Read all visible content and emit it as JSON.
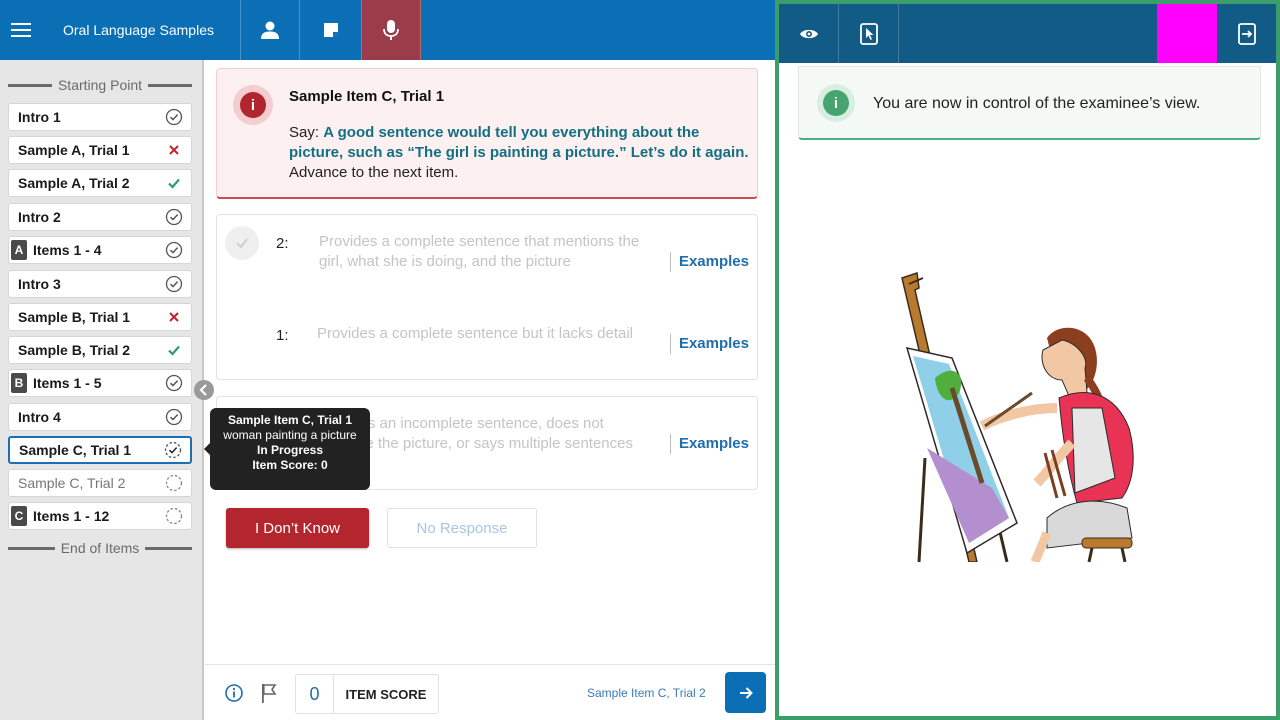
{
  "app": {
    "title": "Oral Language Samples"
  },
  "sidebar": {
    "start_label": "Starting Point",
    "end_label": "End of Items",
    "items": [
      {
        "label": "Intro 1",
        "status": "done"
      },
      {
        "label": "Sample A, Trial 1",
        "status": "incorrect"
      },
      {
        "label": "Sample A, Trial 2",
        "status": "correct"
      },
      {
        "label": "Intro 2",
        "status": "done"
      },
      {
        "badge": "A",
        "label": "Items 1 - 4",
        "status": "done"
      },
      {
        "label": "Intro 3",
        "status": "done"
      },
      {
        "label": "Sample B, Trial 1",
        "status": "incorrect"
      },
      {
        "label": "Sample B, Trial 2",
        "status": "correct"
      },
      {
        "badge": "B",
        "label": "Items 1 - 5",
        "status": "done"
      },
      {
        "label": "Intro 4",
        "status": "done"
      },
      {
        "label": "Sample C, Trial 1",
        "status": "in-progress"
      },
      {
        "label": "Sample C, Trial 2",
        "status": "not-started"
      },
      {
        "badge": "C",
        "label": "Items 1 - 12",
        "status": "not-started"
      }
    ]
  },
  "alert": {
    "title": "Sample Item C, Trial 1",
    "say_prefix": "Say: ",
    "say_highlight": "A good sentence would tell you everything about the picture, such as “The girl is painting a picture.” Let’s do it again.",
    "say_suffix": " Advance to the next item."
  },
  "scoring": [
    {
      "score": "2:",
      "description": "Provides a complete sentence that mentions the girl, what she is doing, and the picture",
      "examples_label": "Examples"
    },
    {
      "score": "1:",
      "description": "Provides a complete sentence but it lacks detail",
      "examples_label": "Examples"
    },
    {
      "score": "0:",
      "description": "Provides an incomplete sentence, does not describe the picture, or says multiple sentences",
      "examples_label": "Examples"
    }
  ],
  "buttons": {
    "dont_know": "I Don’t Know",
    "no_response": "No Response"
  },
  "tooltip": {
    "title": "Sample Item C, Trial 1",
    "subtitle": "woman painting a picture",
    "status": "In Progress",
    "score": "Item Score: 0"
  },
  "footer": {
    "score_value": "0",
    "score_label": "ITEM SCORE",
    "next_item": "Sample Item C, Trial 2"
  },
  "examinee": {
    "notice": "You are now in control of the examinee’s view."
  },
  "colors": {
    "primary": "#0a6fb4",
    "danger": "#b3262e",
    "success": "#3c9e6a",
    "highlight": "#ff00ff"
  }
}
